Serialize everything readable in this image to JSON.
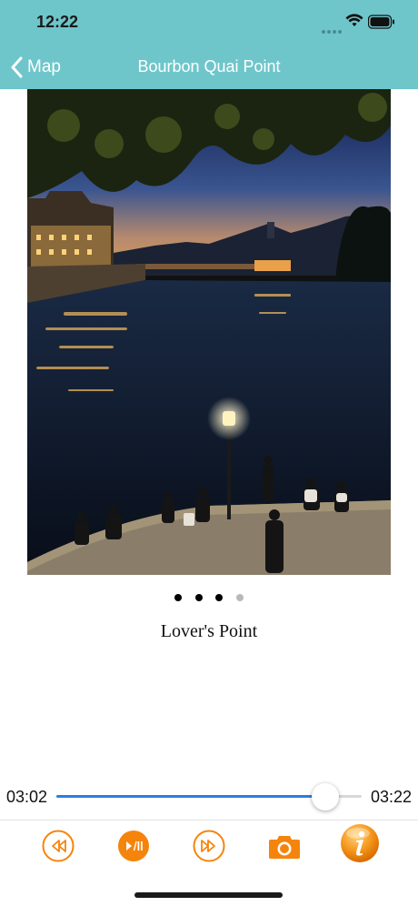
{
  "status_bar": {
    "time": "12:22"
  },
  "nav": {
    "back_label": "Map",
    "title": "Bourbon Quai Point"
  },
  "photo": {
    "description_icon": "photo-image"
  },
  "pager": {
    "total": 4,
    "current": 3
  },
  "caption": "Lover's Point",
  "player": {
    "current_time": "03:02",
    "total_time": "03:22",
    "progress": 0.88
  },
  "controls": {
    "accent": "#f5840c",
    "buttons": [
      "rewind-icon",
      "play-pause-icon",
      "fast-forward-icon",
      "camera-icon",
      "info-icon"
    ]
  },
  "colors": {
    "header": "#6ec6cb",
    "progress": "#2a7fe0"
  }
}
